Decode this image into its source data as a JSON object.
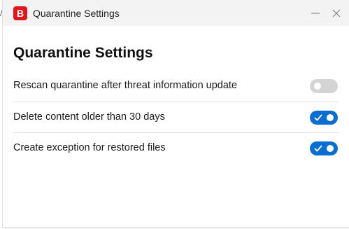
{
  "window": {
    "title": "Quarantine Settings",
    "app_icon_letter": "B",
    "edge_glyph": "/"
  },
  "page": {
    "heading": "Quarantine Settings"
  },
  "settings": [
    {
      "label": "Rescan quarantine after threat information update",
      "enabled": false
    },
    {
      "label": "Delete content older than 30 days",
      "enabled": true
    },
    {
      "label": "Create exception for restored files",
      "enabled": true
    }
  ],
  "colors": {
    "accent": "#0a6ed1",
    "toggle_off": "#d4d4d4",
    "brand_red": "#e0161e"
  },
  "icons": {
    "app": "bitdefender-b-icon",
    "minimize": "minimize-icon",
    "close": "close-icon",
    "toggle_on": "checkmark-icon"
  }
}
